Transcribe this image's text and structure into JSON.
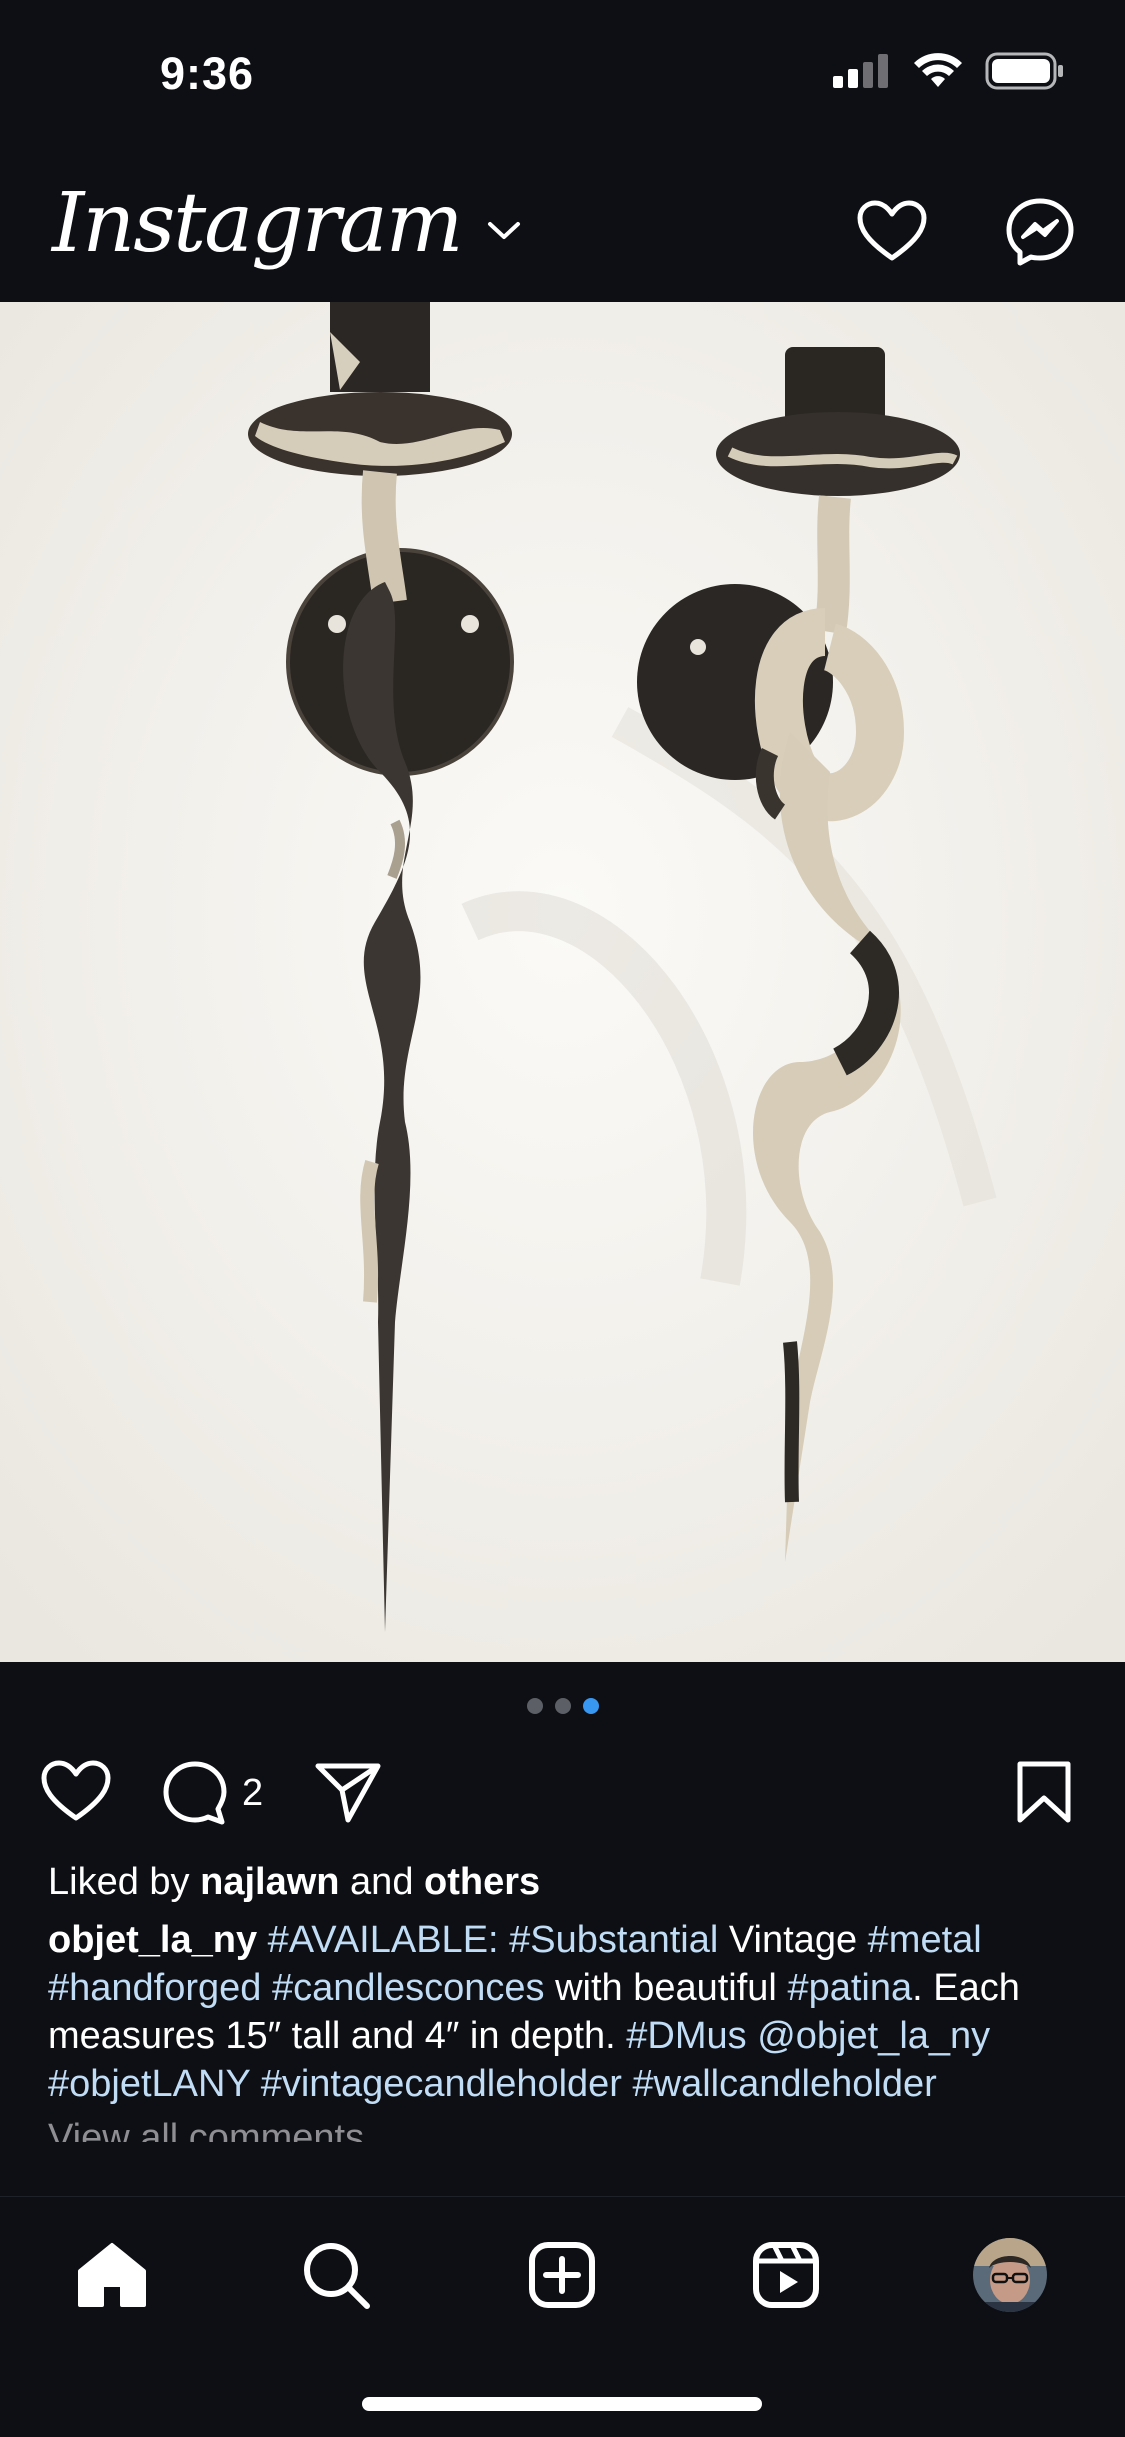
{
  "status_bar": {
    "time": "9:36"
  },
  "header": {
    "brand": "Instagram"
  },
  "carousel": {
    "total": 3,
    "active_index": 2
  },
  "actions": {
    "comment_count": "2"
  },
  "caption": {
    "liked_prefix": "Liked by",
    "liked_user": "najlawn",
    "liked_and": "and",
    "liked_others": "others",
    "username": "objet_la_ny",
    "tag_available": "#AVAILABLE",
    "colon": ":",
    "tag_substantial": "#Substantial",
    "word_vintage": "Vintage",
    "tag_metal": "#metal",
    "tag_handforged": "#handforged",
    "tag_candlesconces": "#candlesconces",
    "word_with_beautiful": "with beautiful",
    "tag_patina": "#patina",
    "sentence": ". Each measures 15″ tall and 4″ in depth.",
    "tag_dmus": "#DMus",
    "mention": "@objet_la_ny",
    "tag_objetlany": "#objetLANY",
    "tag_vintagecandleholder": "#vintagecandleholder",
    "tag_wallcandleholder": "#wallcandleholder",
    "view_all": "View all comments"
  },
  "icons": {
    "header": [
      "heart-icon",
      "messenger-icon"
    ],
    "actions": [
      "like-icon",
      "comment-icon",
      "share-icon",
      "bookmark-icon"
    ],
    "nav": [
      "home-icon",
      "search-icon",
      "new-post-icon",
      "reels-icon",
      "profile-avatar"
    ]
  },
  "colors": {
    "background": "#0d0f14",
    "hashtag": "#c1dcf5",
    "active_dot": "#3897f0"
  }
}
